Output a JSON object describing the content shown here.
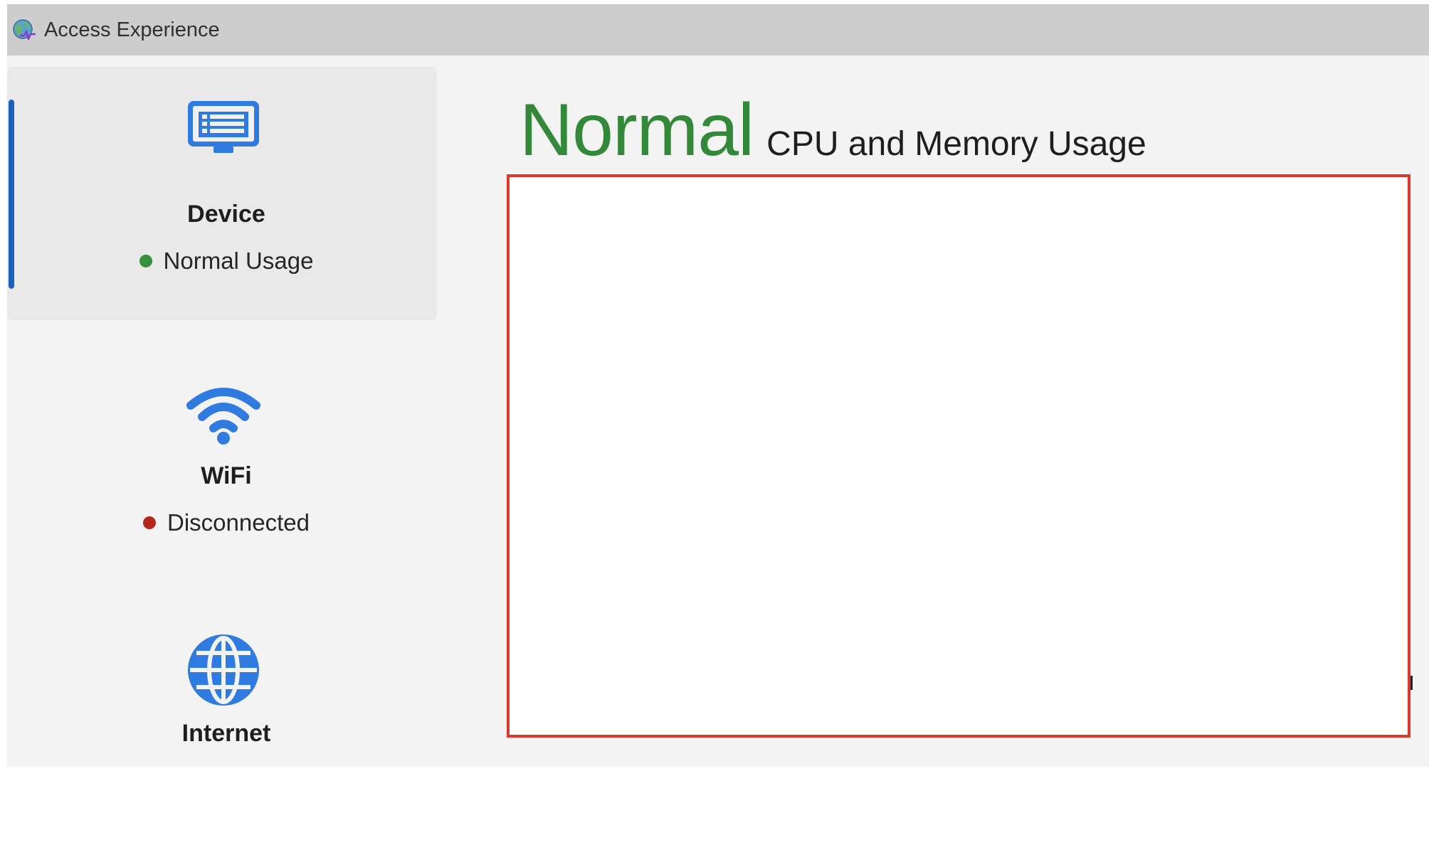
{
  "window": {
    "title": "Access Experience",
    "app_icon": "globe-heartbeat-icon"
  },
  "sidebar": {
    "items": [
      {
        "label": "Device",
        "status": "Normal Usage",
        "status_color": "#3a8f3e",
        "icon": "monitor-icon",
        "selected": true
      },
      {
        "label": "WiFi",
        "status": "Disconnected",
        "status_color": "#b3261e",
        "icon": "wifi-icon",
        "selected": false
      },
      {
        "label": "Internet",
        "icon": "globe-icon",
        "selected": false
      }
    ]
  },
  "main": {
    "status_word": "Normal",
    "status_color": "#33883a",
    "subtitle": "CPU and Memory Usage"
  },
  "colors": {
    "accent": "#2f7be0",
    "selection_indicator": "#1f5fbf",
    "chart_border": "#d93a2b"
  }
}
